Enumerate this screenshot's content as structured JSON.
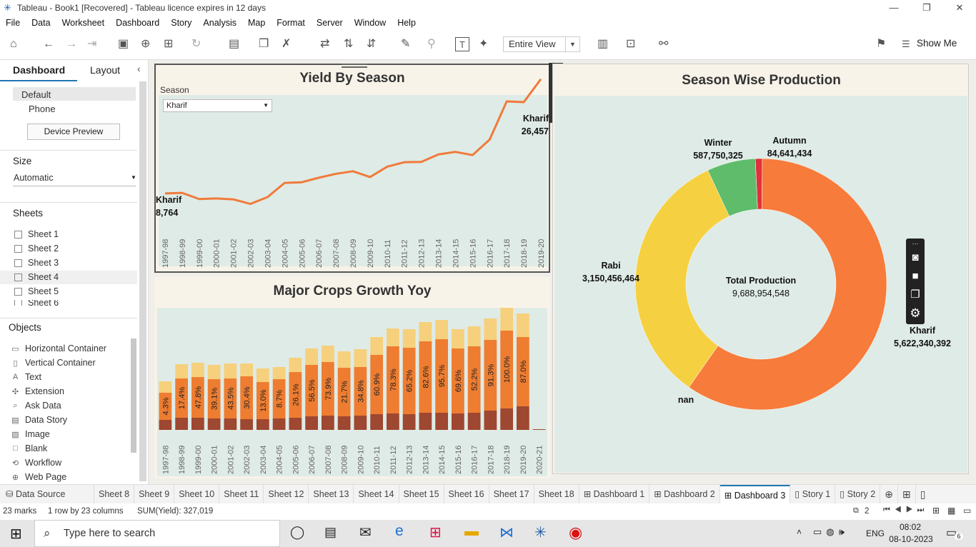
{
  "window": {
    "title": "Tableau - Book1 [Recovered] - Tableau licence expires in 12 days",
    "min": "—",
    "max": "❐",
    "close": "✕"
  },
  "menu": [
    "File",
    "Data",
    "Worksheet",
    "Dashboard",
    "Story",
    "Analysis",
    "Map",
    "Format",
    "Server",
    "Window",
    "Help"
  ],
  "toolbar": {
    "entire_view": "Entire View",
    "show_me": "Show Me"
  },
  "left": {
    "tab_dashboard": "Dashboard",
    "tab_layout": "Layout",
    "default": "Default",
    "phone": "Phone",
    "device_preview": "Device Preview",
    "size_label": "Size",
    "size_value": "Automatic",
    "sheets_label": "Sheets",
    "sheets": [
      "Sheet 1",
      "Sheet 2",
      "Sheet 3",
      "Sheet 4",
      "Sheet 5",
      "Sheet 6"
    ],
    "objects_label": "Objects",
    "objects": [
      "Horizontal Container",
      "Vertical Container",
      "Text",
      "Extension",
      "Ask Data",
      "Data Story",
      "Image",
      "Blank",
      "Workflow",
      "Web Page"
    ]
  },
  "yield_chart": {
    "title": "Yield By Season",
    "filter_label": "Season",
    "filter_value": "Kharif",
    "start_label": "Kharif",
    "start_value": "8,764",
    "end_label": "Kharif",
    "end_value": "26,457"
  },
  "growth_chart": {
    "title": "Major Crops Growth Yoy"
  },
  "donut": {
    "title": "Season Wise Production",
    "center_label": "Total Production",
    "center_value": "9,688,954,548",
    "kharif_label": "Kharif",
    "kharif_value": "5,622,340,392",
    "rabi_label": "Rabi",
    "rabi_value": "3,150,456,464",
    "winter_label": "Winter",
    "winter_value": "587,750,325",
    "autumn_label": "Autumn",
    "autumn_value": "84,641,434",
    "nan_label": "nan"
  },
  "chart_data": [
    {
      "type": "line",
      "title": "Yield By Season",
      "x": [
        "1997-98",
        "1998-99",
        "1999-00",
        "2000-01",
        "2001-02",
        "2002-03",
        "2003-04",
        "2004-05",
        "2005-06",
        "2006-07",
        "2007-08",
        "2008-09",
        "2009-10",
        "2010-11",
        "2011-12",
        "2012-13",
        "2013-14",
        "2014-15",
        "2015-16",
        "2016-17",
        "2017-18",
        "2018-19",
        "2019-20"
      ],
      "series": [
        {
          "name": "Kharif",
          "values": [
            8764,
            8850,
            7900,
            8000,
            7850,
            7150,
            8200,
            10400,
            10500,
            11200,
            11800,
            12200,
            11300,
            12900,
            13600,
            13650,
            14800,
            15200,
            14700,
            17100,
            23000,
            22900,
            26457
          ]
        }
      ],
      "ylim": [
        5000,
        24000
      ],
      "colors": [
        "#f07a3a"
      ]
    },
    {
      "type": "bar",
      "title": "Major Crops Growth Yoy",
      "categories": [
        "1997-98",
        "1998-99",
        "1999-00",
        "2000-01",
        "2001-02",
        "2002-03",
        "2003-04",
        "2004-05",
        "2005-06",
        "2006-07",
        "2007-08",
        "2008-09",
        "2009-10",
        "2010-11",
        "2011-12",
        "2012-13",
        "2013-14",
        "2014-15",
        "2015-16",
        "2016-17",
        "2017-18",
        "2018-19",
        "2019-20",
        "2020-21"
      ],
      "labels": [
        "4.3%",
        "17.4%",
        "47.8%",
        "39.1%",
        "43.5%",
        "30.4%",
        "13.0%",
        "8.7%",
        "26.1%",
        "56.5%",
        "73.9%",
        "21.7%",
        "34.8%",
        "60.9%",
        "78.3%",
        "65.2%",
        "82.6%",
        "95.7%",
        "69.6%",
        "52.2%",
        "91.3%",
        "100.0%",
        "87.0%",
        ""
      ],
      "series": [
        {
          "values": [
            14,
            17,
            17,
            16,
            16,
            15,
            15,
            16,
            17,
            19,
            20,
            19,
            20,
            22,
            23,
            22,
            24,
            24,
            23,
            24,
            27,
            30,
            33,
            1
          ]
        },
        {
          "values": [
            38,
            55,
            57,
            55,
            56,
            60,
            52,
            55,
            64,
            72,
            75,
            68,
            68,
            83,
            94,
            93,
            100,
            103,
            91,
            93,
            99,
            109,
            97,
            0
          ]
        },
        {
          "values": [
            16,
            20,
            20,
            20,
            21,
            18,
            19,
            17,
            20,
            23,
            23,
            23,
            25,
            25,
            25,
            26,
            27,
            27,
            27,
            28,
            30,
            32,
            33,
            0
          ]
        }
      ],
      "colors": [
        "#9e4731",
        "#ee7d31",
        "#f6d07c"
      ]
    },
    {
      "type": "pie",
      "title": "Season Wise Production",
      "labels": [
        "Autumn",
        "Kharif",
        "nan",
        "Rabi",
        "Winter"
      ],
      "values": [
        84641434,
        5622340392,
        1,
        3150456464,
        587750325
      ],
      "colors": [
        "#e0303c",
        "#f77b3a",
        "#f5d040",
        "#f5d040",
        "#5ebc6a"
      ]
    }
  ],
  "bottom_tabs": [
    "Data Source",
    "Sheet 8",
    "Sheet 9",
    "Sheet 10",
    "Sheet 11",
    "Sheet 12",
    "Sheet 13",
    "Sheet 14",
    "Sheet 15",
    "Sheet 16",
    "Sheet 17",
    "Sheet 18",
    "Dashboard 1",
    "Dashboard 2",
    "Dashboard 3",
    "Story 1",
    "Story 2"
  ],
  "status": {
    "marks": "23 marks",
    "rows": "1 row  by 23 columns",
    "sum": "SUM(Yield): 327,019",
    "sheets_count": "2"
  },
  "taskbar": {
    "search_placeholder": "Type here to search",
    "lang": "ENG",
    "time": "08:02",
    "date": "08-10-2023",
    "notif": "6"
  }
}
